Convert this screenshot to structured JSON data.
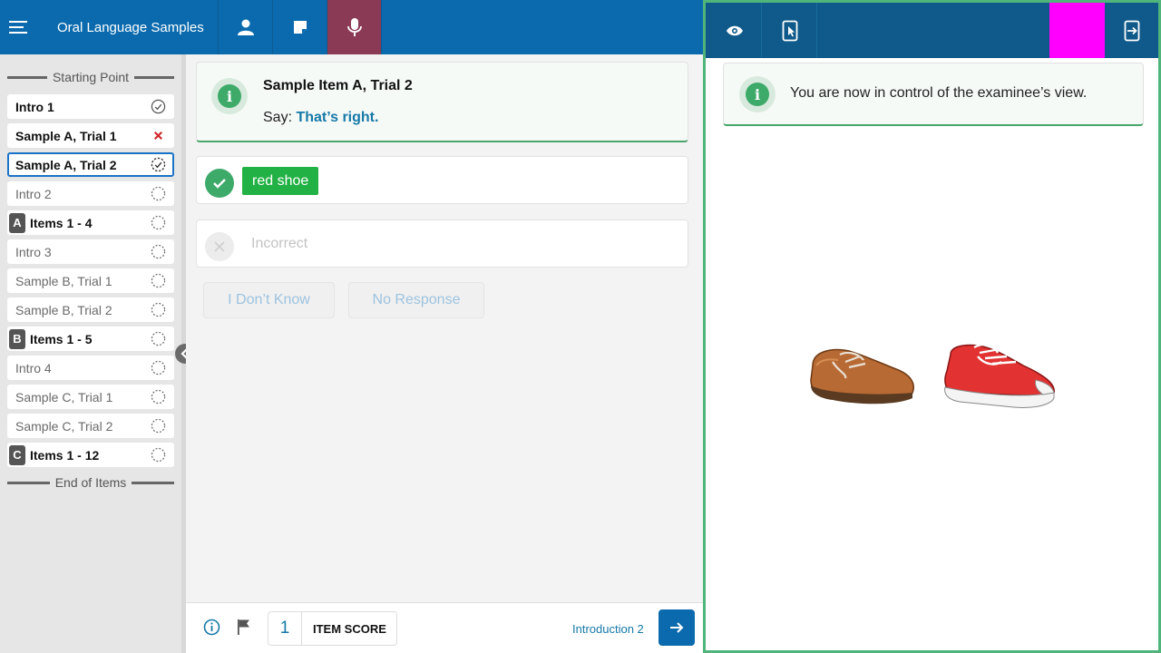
{
  "header": {
    "app_title": "Oral Language Samples",
    "icons": [
      "menu-icon",
      "person-icon",
      "note-icon",
      "microphone-icon"
    ]
  },
  "sidebar": {
    "start_label": "Starting Point",
    "end_label": "End of Items",
    "items": [
      {
        "label": "Intro 1",
        "bold": true,
        "status": "complete",
        "badge": ""
      },
      {
        "label": "Sample A, Trial 1",
        "bold": true,
        "status": "incorrect",
        "badge": ""
      },
      {
        "label": "Sample A, Trial 2",
        "bold": true,
        "status": "current",
        "badge": ""
      },
      {
        "label": "Intro 2",
        "bold": false,
        "status": "pending",
        "badge": ""
      },
      {
        "label": "Items 1 - 4",
        "bold": true,
        "status": "pending",
        "badge": "A"
      },
      {
        "label": "Intro 3",
        "bold": false,
        "status": "pending",
        "badge": ""
      },
      {
        "label": "Sample B, Trial 1",
        "bold": false,
        "status": "pending",
        "badge": ""
      },
      {
        "label": "Sample B, Trial 2",
        "bold": false,
        "status": "pending",
        "badge": ""
      },
      {
        "label": "Items 1 - 5",
        "bold": true,
        "status": "pending",
        "badge": "B"
      },
      {
        "label": "Intro 4",
        "bold": false,
        "status": "pending",
        "badge": ""
      },
      {
        "label": "Sample C, Trial 1",
        "bold": false,
        "status": "pending",
        "badge": ""
      },
      {
        "label": "Sample C, Trial 2",
        "bold": false,
        "status": "pending",
        "badge": ""
      },
      {
        "label": "Items 1 - 12",
        "bold": true,
        "status": "pending",
        "badge": "C"
      }
    ]
  },
  "main": {
    "info_title": "Sample Item A, Trial 2",
    "say_prefix": "Say:",
    "say_text": "That’s right.",
    "correct_response": "red shoe",
    "incorrect_label": "Incorrect",
    "btn_dont_know": "I Don’t Know",
    "btn_no_response": "No Response"
  },
  "footer": {
    "score_value": "1",
    "score_label": "ITEM SCORE",
    "next_label": "Introduction 2"
  },
  "examinee_panel": {
    "notice": "You are now in control of the examinee’s view.",
    "stimulus": [
      "brown-shoe-image",
      "red-sneaker-image"
    ]
  },
  "colors": {
    "header_blue": "#0a6aad",
    "active_mic": "#8a3a55",
    "correct_green": "#22b144",
    "panel_border": "#4fb57a",
    "highlight_magenta": "#ff00ff"
  }
}
